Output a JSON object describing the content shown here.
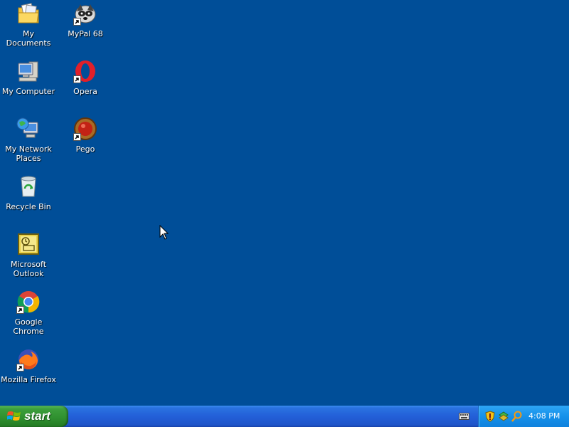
{
  "desktop": {
    "icons": [
      {
        "label": "My Documents",
        "icon": "my-documents-icon"
      },
      {
        "label": "MyPal 68",
        "icon": "mypal-icon",
        "shortcut": true
      },
      {
        "label": "My Computer",
        "icon": "my-computer-icon"
      },
      {
        "label": "Opera",
        "icon": "opera-icon",
        "shortcut": true
      },
      {
        "label": "My Network Places",
        "icon": "network-places-icon"
      },
      {
        "label": "Pego",
        "icon": "pego-icon",
        "shortcut": true
      },
      {
        "label": "Recycle Bin",
        "icon": "recycle-bin-icon"
      },
      {
        "label": "Microsoft Outlook",
        "icon": "outlook-icon"
      },
      {
        "label": "Google Chrome",
        "icon": "chrome-icon",
        "shortcut": true
      },
      {
        "label": "Mozilla Firefox",
        "icon": "firefox-icon",
        "shortcut": true
      }
    ]
  },
  "taskbar": {
    "start_label": "start",
    "clock": "4:08 PM",
    "tray_icons": [
      "security-shield-icon",
      "network-icon",
      "search-icon"
    ]
  },
  "colors": {
    "desktop_bg": "#004e98",
    "taskbar_blue": "#235fd8",
    "start_green": "#3c9f3c",
    "tray_blue": "#1591ea"
  }
}
